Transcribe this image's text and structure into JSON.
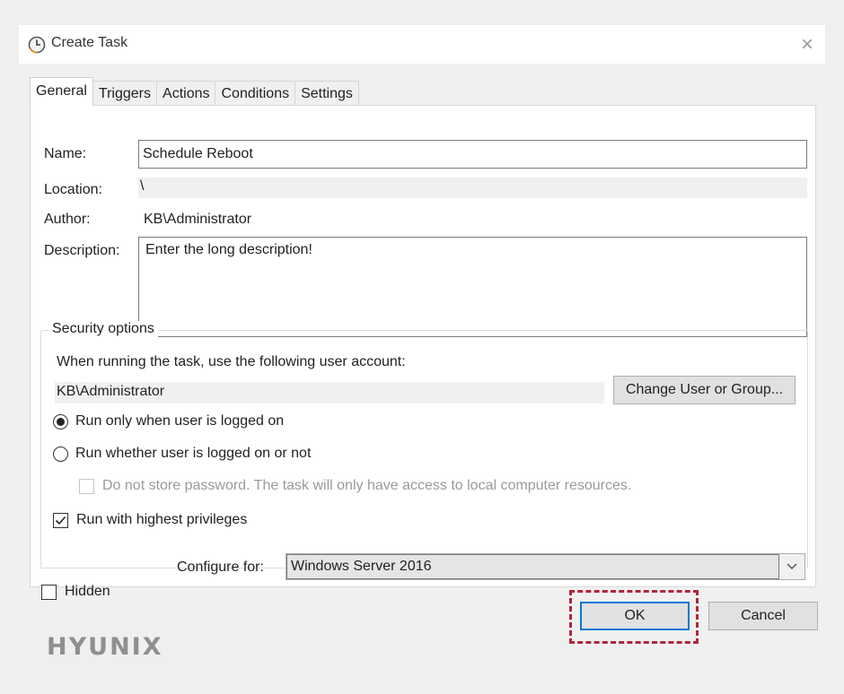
{
  "window": {
    "title": "Create Task",
    "close_glyph": "×"
  },
  "tabs": [
    {
      "label": "General",
      "active": true
    },
    {
      "label": "Triggers",
      "active": false
    },
    {
      "label": "Actions",
      "active": false
    },
    {
      "label": "Conditions",
      "active": false
    },
    {
      "label": "Settings",
      "active": false
    }
  ],
  "general": {
    "name_label": "Name:",
    "name_value": "Schedule Reboot",
    "location_label": "Location:",
    "location_value": "\\",
    "author_label": "Author:",
    "author_value": "KB\\Administrator",
    "description_label": "Description:",
    "description_value": "Enter the long description!"
  },
  "security": {
    "group_title": "Security options",
    "account_prompt": "When running the task, use the following user account:",
    "account_value": "KB\\Administrator",
    "change_button": "Change User or Group...",
    "radio_logged_on": "Run only when user is logged on",
    "radio_logged_on_checked": true,
    "radio_whether": "Run whether user is logged on or not",
    "radio_whether_checked": false,
    "no_store_password": "Do not store password.  The task will only have access to local computer resources.",
    "no_store_password_checked": false,
    "highest_privileges": "Run with highest privileges",
    "highest_privileges_checked": true
  },
  "bottom": {
    "hidden_label": "Hidden",
    "hidden_checked": false,
    "configure_label": "Configure for:",
    "configure_value": "Windows Server 2016"
  },
  "buttons": {
    "ok": "OK",
    "cancel": "Cancel"
  },
  "brand": {
    "logo_text": "HYUNIX",
    "highlight_color": "#b0263a",
    "accent_color": "#0078d7"
  }
}
